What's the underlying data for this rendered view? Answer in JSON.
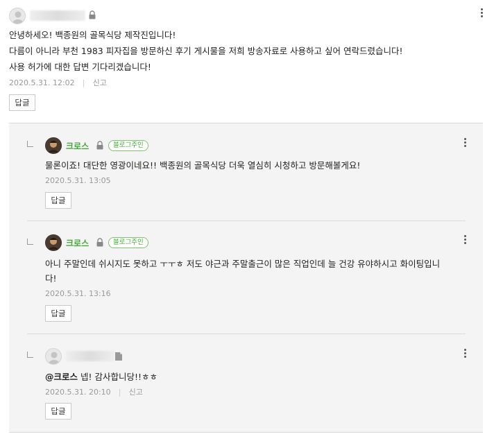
{
  "lock_icon": "lock-icon",
  "comments": [
    {
      "author": "",
      "lines": [
        "안녕하세오! 백종원의 골목식당 제작진입니다!",
        "다름이 아니라 부천 1983 피자집을 방문하신 후기 게시물을 저희 방송자료로 사용하고 싶어 연락드렸습니다!",
        "사용 허가에 대한 답변 기다리겠습니다!"
      ],
      "time": "2020.5.31. 12:02",
      "report": "신고",
      "reply_label": "답글"
    }
  ],
  "replies": [
    {
      "nickname": "크로스",
      "badge": "블로그주인",
      "lines": [
        "물론이죠! 대단한 영광이네요!! 백종원의 골목식당 더욱 열심히 시청하고 방문해볼게요!"
      ],
      "time": "2020.5.31. 13:05",
      "reply_label": "답글"
    },
    {
      "nickname": "크로스",
      "badge": "블로그주인",
      "lines": [
        "아니 주말인데 쉬시지도 못하고 ㅜㅜㅎ 저도 야근과 주말출근이 많은 직업인데 늘 건강 유야하시고 화이팅입니",
        "다!"
      ],
      "time": "2020.5.31. 13:16",
      "reply_label": "답글"
    },
    {
      "mention": "@크로스",
      "text": " 넵! 감사합니당!!ㅎㅎ",
      "time": "2020.5.31. 20:10",
      "report": "신고",
      "reply_label": "답글"
    }
  ],
  "colors": {
    "nickname_green": "#47a83a",
    "reply_background": "#f4f4f4",
    "meta_gray": "#999999"
  }
}
